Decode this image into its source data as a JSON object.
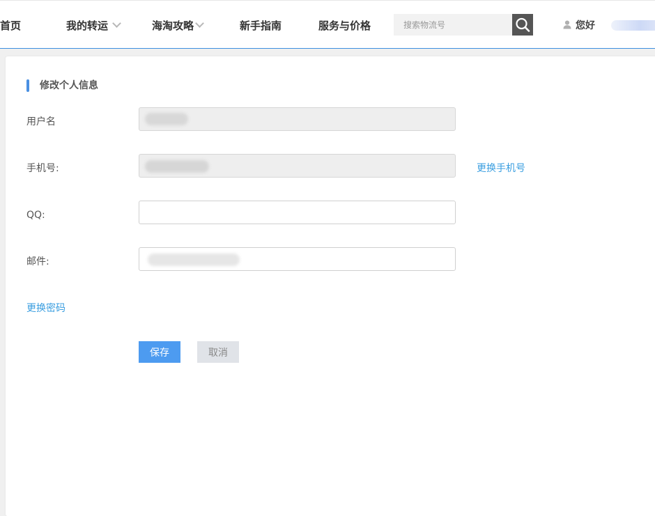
{
  "nav": {
    "home": "首页",
    "my_forwarding": "我的转运",
    "haitao_guide": "海淘攻略",
    "newbie_guide": "新手指南",
    "service_price": "服务与价格"
  },
  "search": {
    "placeholder": "搜索物流号",
    "value": ""
  },
  "user": {
    "greeting": "您好"
  },
  "form": {
    "title": "修改个人信息",
    "username_label": "用户名",
    "phone_label": "手机号:",
    "change_phone_link": "更换手机号",
    "qq_label": "QQ:",
    "qq_value": "",
    "email_label": "邮件:",
    "change_password_link": "更换密码",
    "save_label": "保存",
    "cancel_label": "取消"
  },
  "colors": {
    "accent": "#4a90e2",
    "link": "#3a9ee0",
    "save_button": "#4d9bf0",
    "cancel_button": "#e0e3e8",
    "search_button": "#555555"
  },
  "icons": {
    "nav_dropdown": "chevron-down-icon",
    "search": "search-icon",
    "user": "user-icon"
  }
}
